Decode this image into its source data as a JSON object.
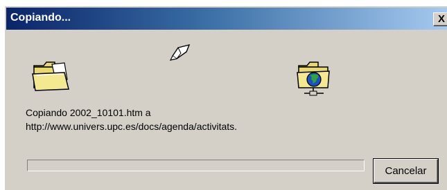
{
  "window": {
    "title": "Copiando...",
    "close_label": "X"
  },
  "message": {
    "line1": "Copiando 2002_10101.htm a",
    "line2": "http://www.univers.upc.es/docs/agenda/activitats."
  },
  "progress": {
    "fraction": 0
  },
  "buttons": {
    "cancel_label": "Cancelar"
  },
  "icons": {
    "source": "folder-icon",
    "flying": "flying-document-icon",
    "destination": "web-folder-icon"
  },
  "colors": {
    "titlebar_start": "#0a246a",
    "titlebar_end": "#a6caf0",
    "window_face": "#d4d0c8",
    "progress_fill": "#0a246a"
  }
}
